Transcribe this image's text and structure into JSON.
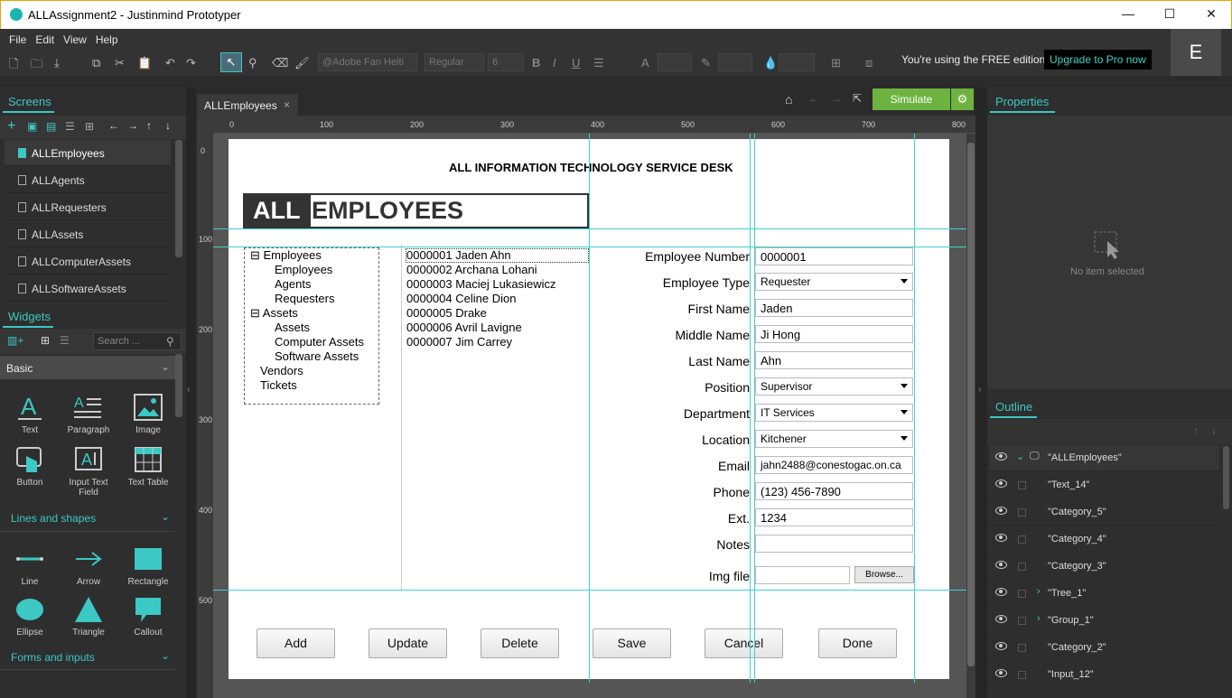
{
  "window": {
    "title": "ALLAssignment2 - Justinmind Prototyper",
    "minimize": "—",
    "maximize": "☐",
    "close": "✕"
  },
  "menu": [
    "File",
    "Edit",
    "View",
    "Help"
  ],
  "toolbar": {
    "font": "@Adobe Fan Heiti",
    "style": "Regular",
    "size": "6",
    "bold": "B",
    "italic": "I",
    "underline": "U",
    "free_text": "You're using the FREE edition",
    "upgrade": "Upgrade to Pro now",
    "user_initial": "E"
  },
  "screens": {
    "title": "Screens",
    "items": [
      "ALLEmployees",
      "ALLAgents",
      "ALLRequesters",
      "ALLAssets",
      "ALLComputerAssets",
      "ALLSoftwareAssets"
    ],
    "selected": "ALLEmployees"
  },
  "widgets": {
    "title": "Widgets",
    "search_placeholder": "Search ...",
    "category": "Basic",
    "basic": [
      "Text",
      "Paragraph",
      "Image",
      "Button",
      "Input Text Field",
      "Text Table"
    ],
    "lines_title": "Lines and shapes",
    "lines": [
      "Line",
      "Arrow",
      "Rectangle",
      "Ellipse",
      "Triangle",
      "Callout"
    ],
    "forms_title": "Forms and inputs"
  },
  "canvas": {
    "tab": "ALLEmployees",
    "tab_close": "×",
    "simulate": "Simulate",
    "hruler": [
      "0",
      "100",
      "200",
      "300",
      "400",
      "500",
      "600",
      "700",
      "800"
    ],
    "vruler": [
      "0",
      "100",
      "200",
      "300",
      "400",
      "500"
    ]
  },
  "page": {
    "header": "ALL INFORMATION TECHNOLOGY SERVICE DESK",
    "title_a": "ALL",
    "title_b": "EMPLOYEES",
    "tree": [
      "Employees",
      "Employees",
      "Agents",
      "Requesters",
      "Assets",
      "Assets",
      "Computer Assets",
      "Software Assets",
      "Vendors",
      "Tickets"
    ],
    "list": [
      "0000001 Jaden Ahn",
      "0000002 Archana Lohani",
      "0000003 Maciej Lukasiewicz",
      "0000004 Celine Dion",
      "0000005 Drake",
      "0000006 Avril Lavigne",
      "0000007 Jim Carrey"
    ],
    "fields": [
      {
        "label": "Employee Number",
        "value": "0000001",
        "type": "text"
      },
      {
        "label": "Employee Type",
        "value": "Requester",
        "type": "select"
      },
      {
        "label": "First Name",
        "value": "Jaden",
        "type": "text"
      },
      {
        "label": "Middle Name",
        "value": "Ji Hong",
        "type": "text"
      },
      {
        "label": "Last Name",
        "value": "Ahn",
        "type": "text"
      },
      {
        "label": "Position",
        "value": "Supervisor",
        "type": "select"
      },
      {
        "label": "Department",
        "value": "IT Services",
        "type": "select"
      },
      {
        "label": "Location",
        "value": "Kitchener",
        "type": "select"
      },
      {
        "label": "Email",
        "value": "jahn2488@conestogac.on.ca",
        "type": "text"
      },
      {
        "label": "Phone",
        "value": "(123) 456-7890",
        "type": "text"
      },
      {
        "label": "Ext.",
        "value": "1234",
        "type": "text"
      },
      {
        "label": "Notes",
        "value": "",
        "type": "text"
      }
    ],
    "img_label": "Img file",
    "browse": "Browse...",
    "buttons": [
      "Add",
      "Update",
      "Delete",
      "Save",
      "Cancel",
      "Done"
    ]
  },
  "properties": {
    "title": "Properties",
    "empty": "No item selected"
  },
  "outline": {
    "title": "Outline",
    "items": [
      "\"ALLEmployees\"",
      "\"Text_14\"",
      "\"Category_5\"",
      "\"Category_4\"",
      "\"Category_3\"",
      "\"Tree_1\"",
      "\"Group_1\"",
      "\"Category_2\"",
      "\"Input_12\""
    ]
  },
  "colors": {
    "accent": "#3cc8c4",
    "simulate": "#6db33f",
    "guide": "#3fd2d2"
  }
}
